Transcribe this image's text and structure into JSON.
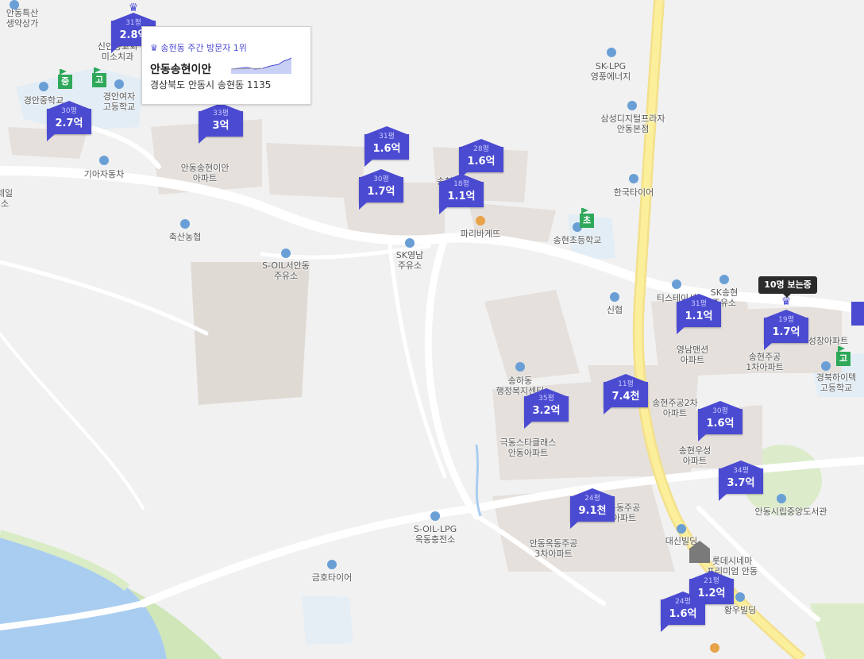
{
  "popup": {
    "rank_text": "송현동 주간 방문자 1위",
    "name": "안동송현이안",
    "address": "경상북도 안동시 송현동 1135"
  },
  "viewers_badge": "10명 보는중",
  "markers": [
    {
      "size": "31평",
      "price": "2.8억"
    },
    {
      "size": "30평",
      "price": "2.7억"
    },
    {
      "size": "33평",
      "price": "3억"
    },
    {
      "size": "31평",
      "price": "1.6억"
    },
    {
      "size": "30평",
      "price": "1.7억"
    },
    {
      "size": "28평",
      "price": "1.6억"
    },
    {
      "size": "18평",
      "price": "1.1억"
    },
    {
      "size": "31평",
      "price": "1.1억"
    },
    {
      "size": "19평",
      "price": "1.7억"
    },
    {
      "size": "35평",
      "price": "3.2억"
    },
    {
      "size": "11평",
      "price": "7.4천"
    },
    {
      "size": "30평",
      "price": "1.6억"
    },
    {
      "size": "34평",
      "price": "3.7억"
    },
    {
      "size": "24평",
      "price": "9.1천"
    },
    {
      "size": "21평",
      "price": "1.2억"
    },
    {
      "size": "24평",
      "price": "1.6억"
    }
  ],
  "labels": [
    "안동특산\n생약상가",
    "신안동교회\n미소치과",
    "경안중학교",
    "경안여자\n고등학교",
    "기아자동차",
    "안동송현이안\n아파트",
    "축산농협",
    "S-OIL서안동\n주유소",
    "SK영남\n주유소",
    "파리바게뜨",
    "송현초등학교",
    "한국타이어",
    "SK-LPG\n영풍에너지",
    "삼성디지털프라자\n안동본점",
    "신협",
    "티스테이션",
    "SK송현\n주유소",
    "영남맨션\n아파트",
    "송현주공\n1차아파트",
    "성창아파트",
    "경북하이텍\n고등학교",
    "송하동\n행정복지센터",
    "극동스타클래스\n안동아파트",
    "송현주공2차\n아파트",
    "송현우성\n아파트",
    "안동시립중앙도서관",
    "옥동주공\n아파트",
    "안동옥동주공\n3차아파트",
    "S-OIL-LPG\n옥동충전소",
    "금호타이어",
    "대신빌딩",
    "롯데시네마\n프리미엄 안동",
    "황우빌딩",
    "제일\n소",
    "송현\n운"
  ],
  "flags": [
    "중",
    "고",
    "초",
    "고"
  ]
}
